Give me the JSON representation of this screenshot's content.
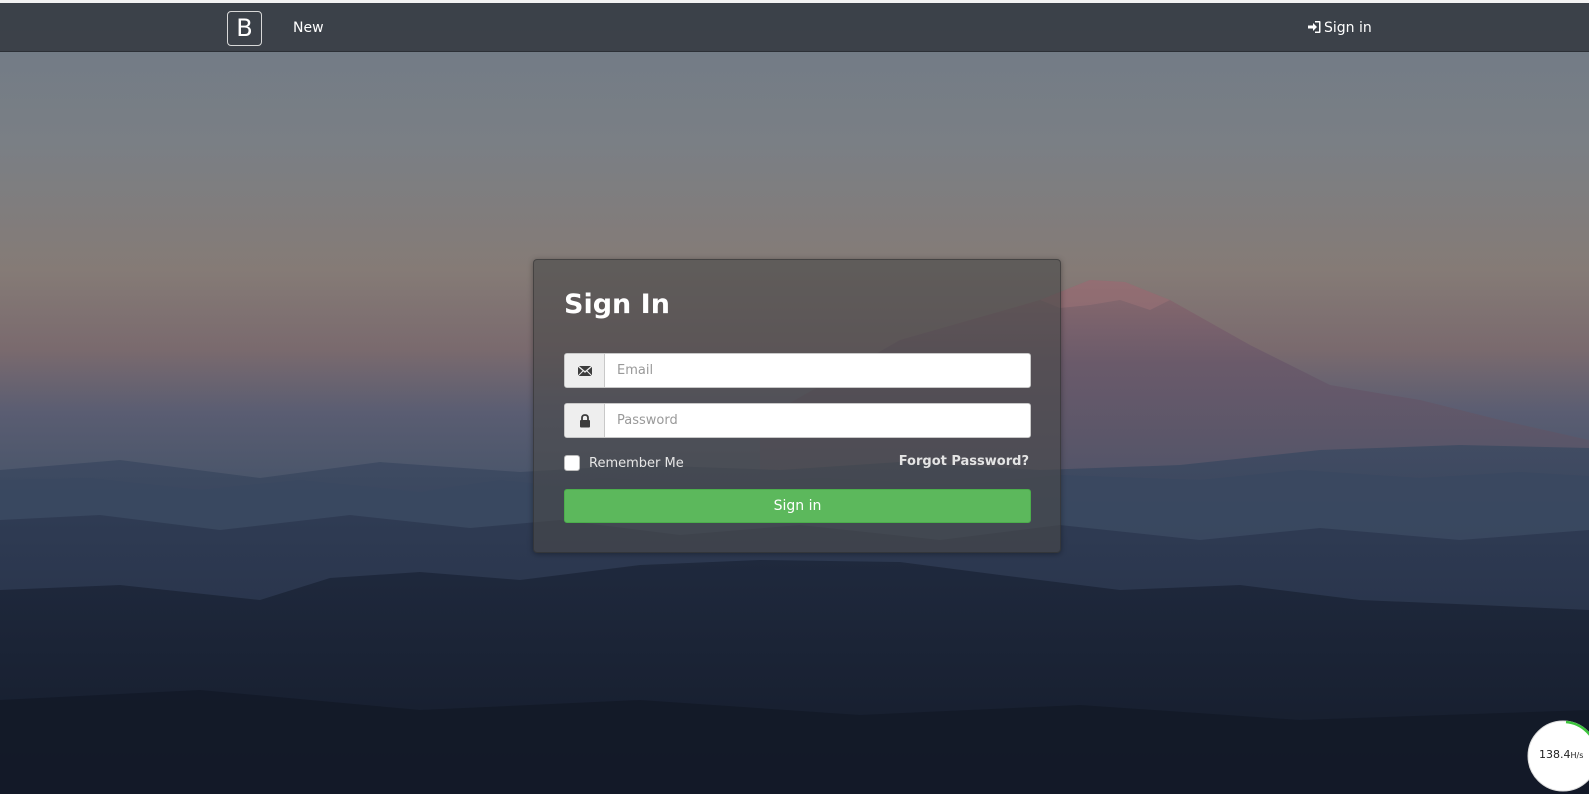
{
  "navbar": {
    "brand_label": "B",
    "new_label": "New",
    "signin_label": "Sign in"
  },
  "login": {
    "title": "Sign In",
    "email_placeholder": "Email",
    "password_placeholder": "Password",
    "remember_label": "Remember Me",
    "remember_checked": false,
    "forgot_label": "Forgot Password?",
    "submit_label": "Sign in"
  },
  "speed_widget": {
    "value": "138.4",
    "unit": "H/s"
  },
  "colors": {
    "navbar_bg": "#3a3f47",
    "button_green": "#5cb85c",
    "panel_bg": "#484848"
  },
  "icons": {
    "nav_signin": "sign-in-icon",
    "email": "envelope-icon",
    "password": "lock-icon"
  }
}
